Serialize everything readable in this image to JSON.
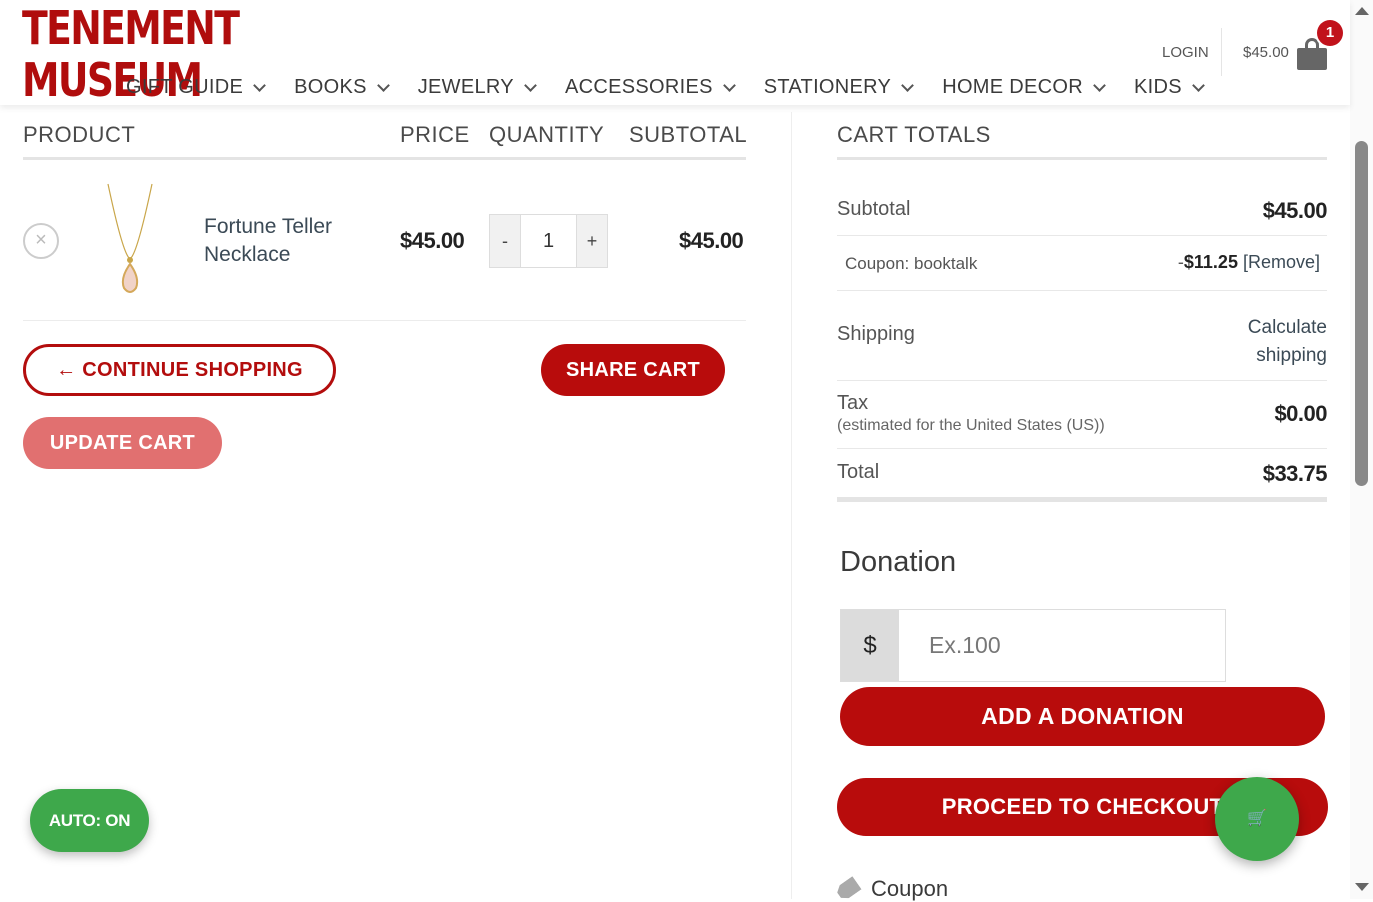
{
  "header": {
    "logo_line1": "TENEMENT",
    "logo_line2": "MUSEUM",
    "nav": [
      "GIFT GUIDE",
      "BOOKS",
      "JEWELRY",
      "ACCESSORIES",
      "STATIONERY",
      "HOME DECOR",
      "KIDS"
    ],
    "login": "LOGIN",
    "cart_total": "$45.00",
    "cart_count": "1"
  },
  "cart": {
    "headers": {
      "product": "PRODUCT",
      "price": "PRICE",
      "quantity": "QUANTITY",
      "subtotal": "SUBTOTAL"
    },
    "item": {
      "remove": "×",
      "name": "Fortune Teller Necklace",
      "price": "$45.00",
      "qty_minus": "-",
      "qty": "1",
      "qty_plus": "+",
      "subtotal": "$45.00"
    },
    "continue_shopping": "← CONTINUE SHOPPING",
    "share_cart": "SHARE CART",
    "update_cart": "UPDATE CART"
  },
  "totals": {
    "title": "CART TOTALS",
    "subtotal_label": "Subtotal",
    "subtotal_value": "$45.00",
    "coupon_label": "Coupon: booktalk",
    "coupon_dash": "-",
    "coupon_amount": "$11.25",
    "coupon_remove": "[Remove]",
    "shipping_label": "Shipping",
    "shipping_line1": "Calculate",
    "shipping_line2": "shipping",
    "tax_label": "Tax",
    "tax_note": "(estimated for the United States (US))",
    "tax_value": "$0.00",
    "total_label": "Total",
    "total_value": "$33.75"
  },
  "donation": {
    "title": "Donation",
    "currency": "$",
    "placeholder": "Ex.100",
    "button": "ADD A DONATION"
  },
  "checkout_button": "PROCEED TO CHECKOUT",
  "coupon_heading": "Coupon",
  "auto_toggle": "AUTO: ON",
  "fab_icon": "🛒"
}
